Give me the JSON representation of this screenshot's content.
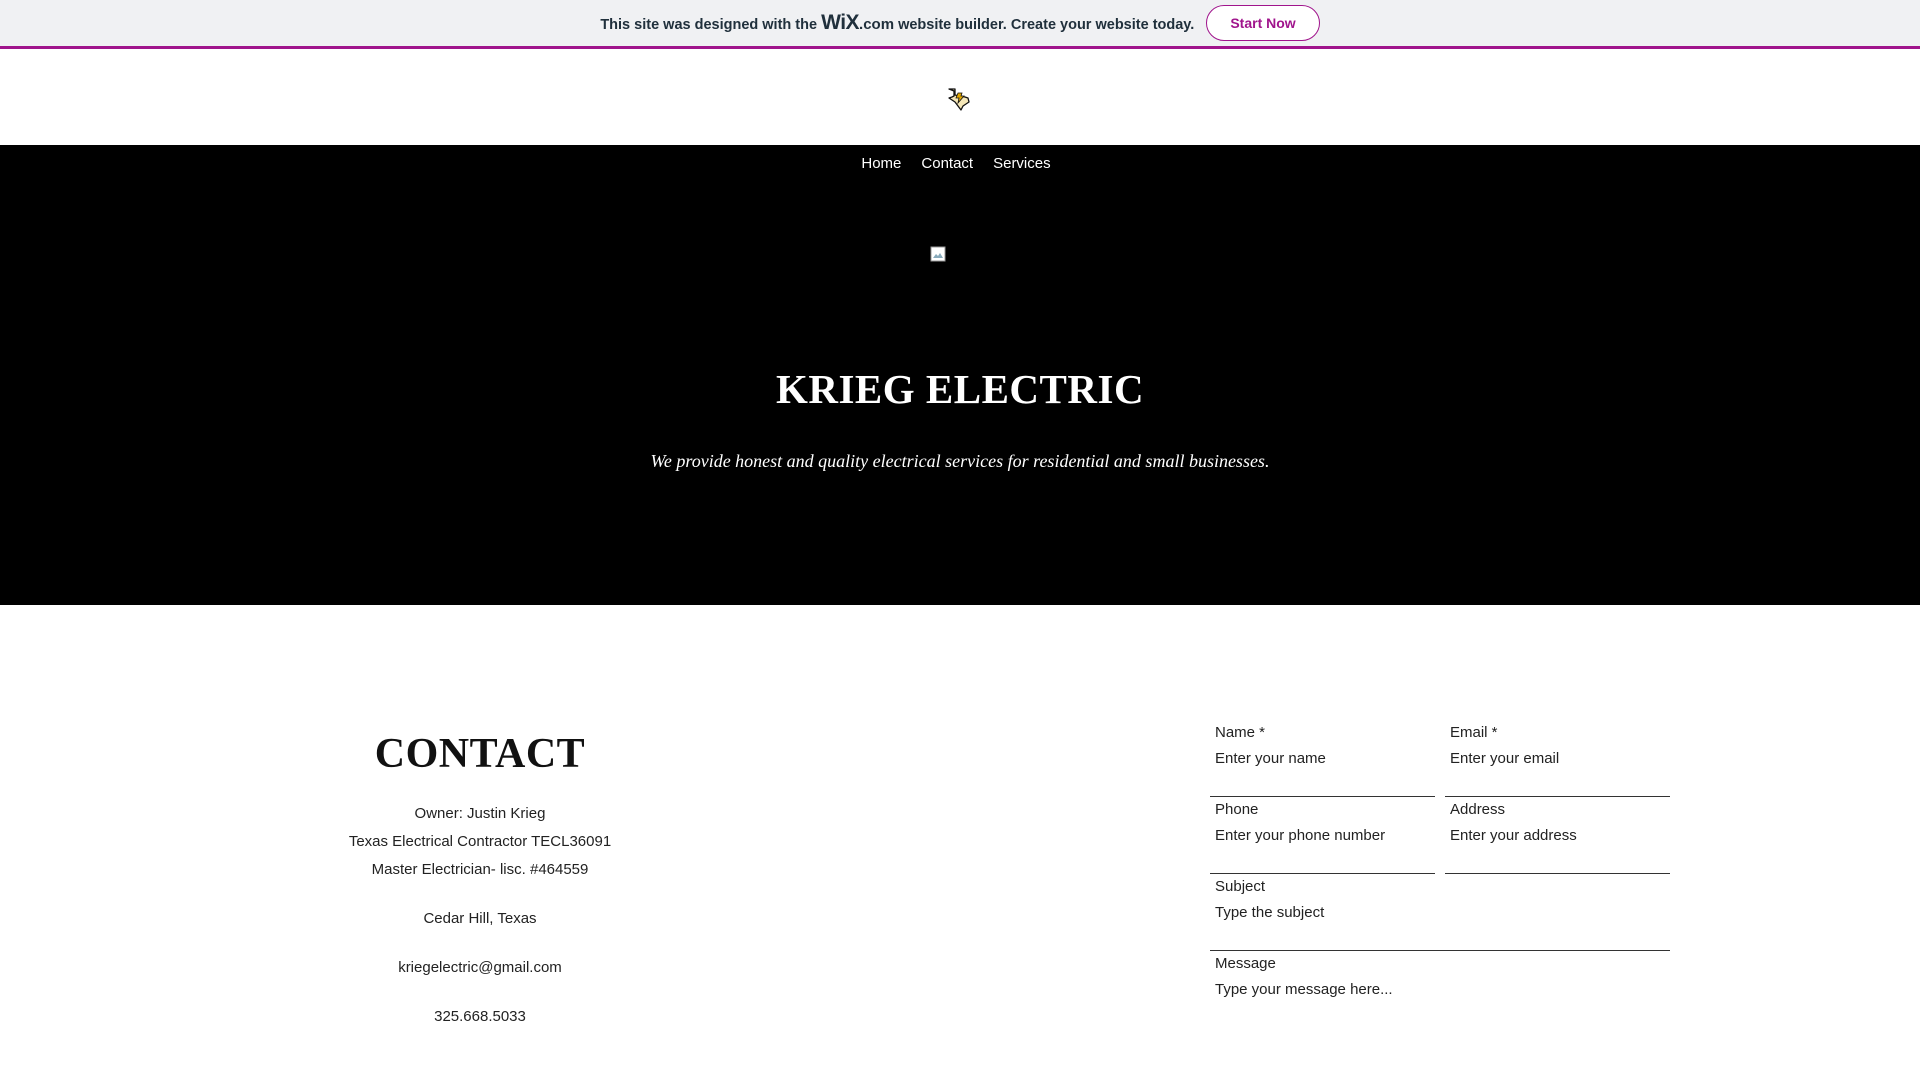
{
  "banner": {
    "text_before": "This site was designed with the",
    "wix_logo": "WiX",
    "wix_com": ".com",
    "text_after": "website builder. Create your website today.",
    "start_button": "Start Now",
    "accent_color": "#a0148c"
  },
  "header": {
    "logo_icon": "texas-map-logo-icon"
  },
  "nav": {
    "items": [
      "Home",
      "Contact",
      "Services"
    ]
  },
  "hero": {
    "image_icon": "broken-image-icon",
    "title": "KRIEG ELECTRIC",
    "subtitle": "We provide honest and quality electrical services for residential and small businesses."
  },
  "contact": {
    "title": "CONTACT",
    "owner": "Owner: Justin Krieg",
    "license_contractor": "Texas Electrical Contractor TECL36091",
    "license_master": "Master Electrician- lisc. #464559",
    "location": "Cedar Hill, Texas",
    "email": "kriegelectric@gmail.com",
    "phone": "325.668.5033"
  },
  "form": {
    "name_label": "Name *",
    "name_placeholder": "Enter your name",
    "email_label": "Email *",
    "email_placeholder": "Enter your email",
    "phone_label": "Phone",
    "phone_placeholder": "Enter your phone number",
    "address_label": "Address",
    "address_placeholder": "Enter your address",
    "subject_label": "Subject",
    "subject_placeholder": "Type the subject",
    "message_label": "Message",
    "message_placeholder": "Type your message here..."
  }
}
